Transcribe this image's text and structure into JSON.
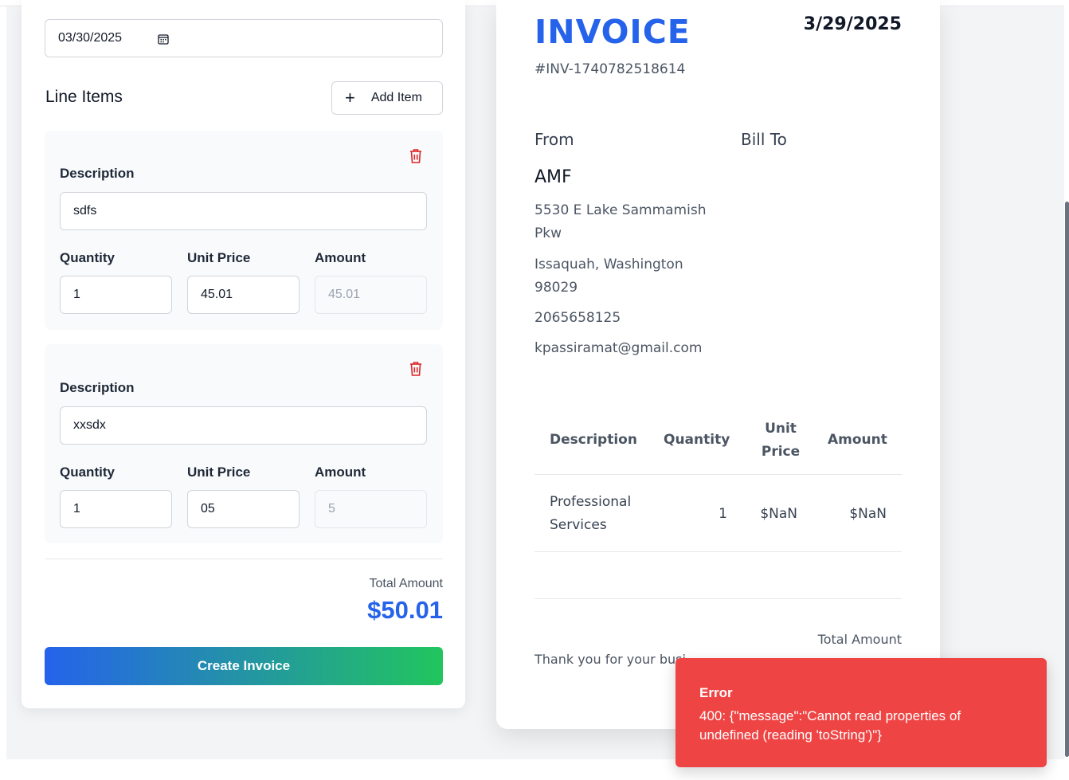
{
  "form": {
    "date_value": "03/30/2025",
    "section_title": "Line Items",
    "add_item_label": "Add Item",
    "line_items": [
      {
        "description_label": "Description",
        "description": "sdfs",
        "quantity_label": "Quantity",
        "quantity": "1",
        "unit_price_label": "Unit Price",
        "unit_price": "45.01",
        "amount_label": "Amount",
        "amount": "45.01"
      },
      {
        "description_label": "Description",
        "description": "xxsdx",
        "quantity_label": "Quantity",
        "quantity": "1",
        "unit_price_label": "Unit Price",
        "unit_price": "05",
        "amount_label": "Amount",
        "amount": "5"
      }
    ],
    "total_label": "Total Amount",
    "total_value": "$50.01",
    "create_label": "Create Invoice"
  },
  "invoice": {
    "title": "INVOICE",
    "date": "3/29/2025",
    "number": "#INV-1740782518614",
    "from_label": "From",
    "bill_to_label": "Bill To",
    "company": "AMF",
    "address_line": "5530 E Lake Sammamish Pkw",
    "city_line": "Issaquah, Washington 98029",
    "phone": "2065658125",
    "email": "kpassiramat@gmail.com",
    "table": {
      "headers": [
        "Description",
        "Quantity",
        "Unit Price",
        "Amount"
      ],
      "rows": [
        {
          "description": "Professional Services",
          "quantity": "1",
          "unit_price": "$NaN",
          "amount": "$NaN"
        }
      ]
    },
    "thanks_text": "Thank you for your busi",
    "total_label": "Total Amount"
  },
  "toast": {
    "title": "Error",
    "message": "400: {\"message\":\"Cannot read properties of undefined (reading 'toString')\"}"
  },
  "colors": {
    "accent": "#2563eb",
    "gradient_end": "#22c55e",
    "error": "#ef4444",
    "delete": "#dc2626"
  }
}
